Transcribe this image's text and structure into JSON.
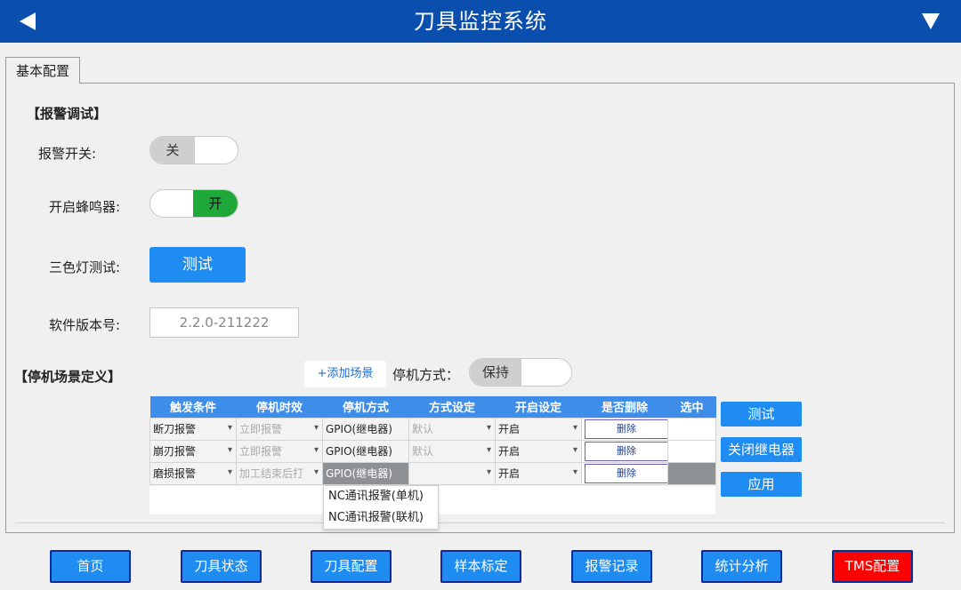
{
  "app": {
    "title": "刀具监控系统"
  },
  "tab": {
    "label": "基本配置"
  },
  "alarm": {
    "section_title": "【报警调试】",
    "switch_label": "报警开关:",
    "switch_value": "关",
    "buzzer_label": "开启蜂鸣器:",
    "buzzer_value": "开",
    "light_label": "三色灯测试:",
    "light_button": "测试",
    "version_label": "软件版本号:",
    "version_value": "2.2.0-211222"
  },
  "stop": {
    "section_title": "【停机场景定义】",
    "add_scene": "+添加场景",
    "mode_label": "停机方式：",
    "mode_value": "保持",
    "columns": [
      "触发条件",
      "停机时效",
      "停机方式",
      "方式设定",
      "开启设定",
      "是否删除",
      "选中"
    ],
    "rows": [
      {
        "trigger": "断刀报警",
        "timing": "立即报警",
        "method": "GPIO(继电器)",
        "setting": "默认",
        "enable": "开启",
        "delete": "删除"
      },
      {
        "trigger": "崩刃报警",
        "timing": "立即报警",
        "method": "GPIO(继电器)",
        "setting": "默认",
        "enable": "开启",
        "delete": "删除"
      },
      {
        "trigger": "磨损报警",
        "timing": "加工结束后打",
        "method": "GPIO(继电器)",
        "setting": "",
        "enable": "开启",
        "delete": "删除"
      }
    ],
    "dropdown_options": [
      "NC通讯报警(单机)",
      "NC通讯报警(联机)"
    ],
    "side_buttons": {
      "test": "测试",
      "close_relay": "关闭继电器",
      "apply": "应用"
    }
  },
  "nav": [
    "首页",
    "刀具状态",
    "刀具配置",
    "样本标定",
    "报警记录",
    "统计分析",
    "TMS配置"
  ],
  "colors": {
    "header": "#0b4fae",
    "accent": "#1e8cf0",
    "on": "#1fa83a",
    "active_nav": "#ff0000"
  }
}
